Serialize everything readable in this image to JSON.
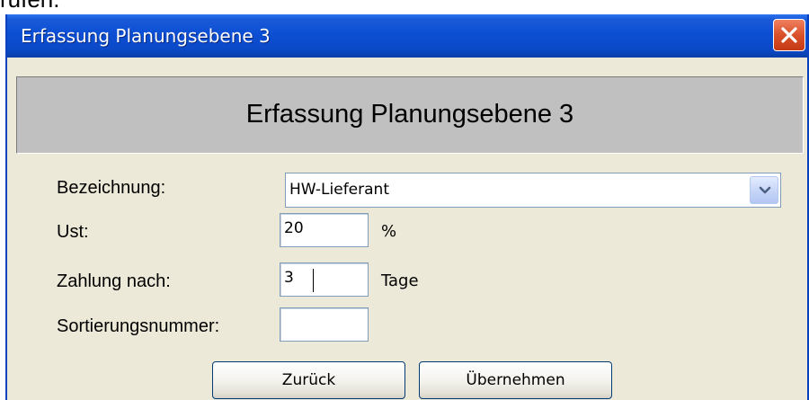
{
  "page": {
    "top_text": "rufen."
  },
  "window": {
    "title": "Erfassung Planungsebene 3",
    "header_title": "Erfassung Planungsebene 3"
  },
  "form": {
    "bezeichnung_label": "Bezeichnung:",
    "bezeichnung_value": "HW-Lieferant",
    "ust_label": "Ust:",
    "ust_value": "20",
    "ust_unit": "%",
    "zahlung_label": "Zahlung nach:",
    "zahlung_value": "3",
    "zahlung_unit": "Tage",
    "sortierung_label": "Sortierungsnummer:",
    "sortierung_value": ""
  },
  "buttons": {
    "back_label": "Zurück",
    "apply_label": "Übernehmen"
  },
  "icons": {
    "close": "close-icon",
    "dropdown": "chevron-down-icon"
  },
  "colors": {
    "titlebar": "#0b49c8",
    "close_button": "#d9512a",
    "window_bg": "#ece9d8",
    "header_bg": "#c0c0c0"
  }
}
